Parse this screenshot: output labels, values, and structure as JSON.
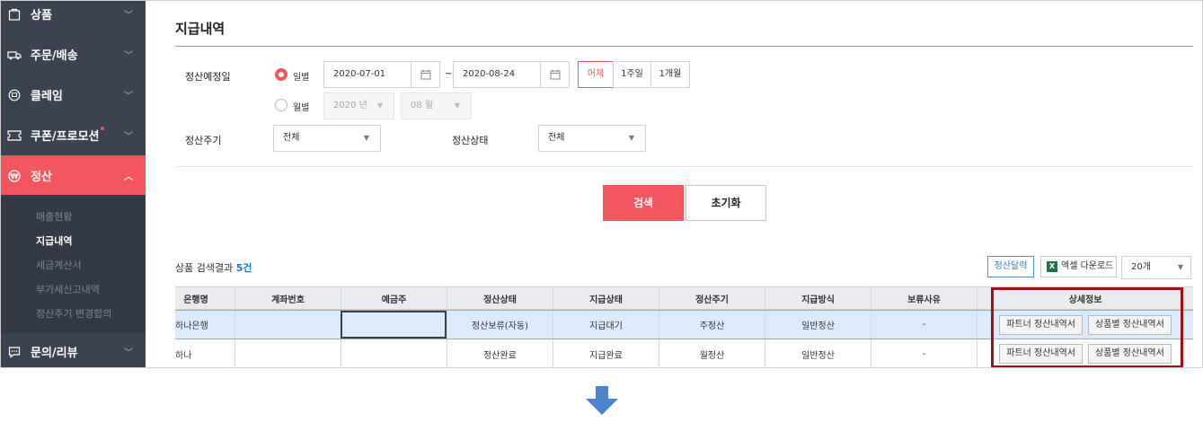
{
  "sidebar": {
    "items": [
      {
        "label": "상품",
        "icon": "store-icon"
      },
      {
        "label": "주문/배송",
        "icon": "truck-icon"
      },
      {
        "label": "클레임",
        "icon": "claim-icon"
      },
      {
        "label": "쿠폰/프로모션",
        "icon": "coupon-icon"
      },
      {
        "label": "정산",
        "icon": "won-icon"
      },
      {
        "label": "문의/리뷰",
        "icon": "chat-icon"
      }
    ],
    "submenu": [
      "매출현황",
      "지급내역",
      "세금계산서",
      "부가세신고내역",
      "정산주기 변경합의"
    ]
  },
  "page": {
    "title": "지급내역"
  },
  "filters": {
    "date_label": "정산예정일",
    "radio_daily": "일별",
    "radio_monthly": "월별",
    "date_from": "2020-07-01",
    "date_sep": "~",
    "date_to": "2020-08-24",
    "quick_periods": [
      "어제",
      "1주일",
      "1개월"
    ],
    "year_select": "2020 년",
    "month_select": "08 월",
    "cycle_label": "정산주기",
    "cycle_value": "전체",
    "status_label": "정산상태",
    "status_value": "전체"
  },
  "actions": {
    "search": "검색",
    "reset": "초기화"
  },
  "results": {
    "label": "상품 검색결과",
    "count": "5건",
    "settle_print": "정산달력",
    "excel_icon": "X",
    "excel_download": "엑셀 다운로드",
    "page_size": "20개"
  },
  "table": {
    "headers": [
      "은행명",
      "계좌번호",
      "예금주",
      "정산상태",
      "지급상태",
      "정산주기",
      "지급방식",
      "보류사유",
      "상세정보"
    ],
    "rows": [
      {
        "bank": "하나은행",
        "account": "",
        "holder": "",
        "settle_status": "정산보류(자동)",
        "pay_status": "지급대기",
        "cycle": "주정산",
        "method": "일반정산",
        "reason": "-",
        "btn1": "파트너 정산내역서",
        "btn2": "상품별 정산내역서"
      },
      {
        "bank": "하나",
        "account": "",
        "holder": "",
        "settle_status": "정산완료",
        "pay_status": "지급완료",
        "cycle": "월정산",
        "method": "일반정산",
        "reason": "-",
        "btn1": "파트너 정산내역서",
        "btn2": "상품별 정산내역서"
      }
    ]
  },
  "colors": {
    "accent": "#f3565d",
    "sidebar": "#3c4350",
    "highlight_box": "#a30f14",
    "arrow": "#4a84d0"
  }
}
